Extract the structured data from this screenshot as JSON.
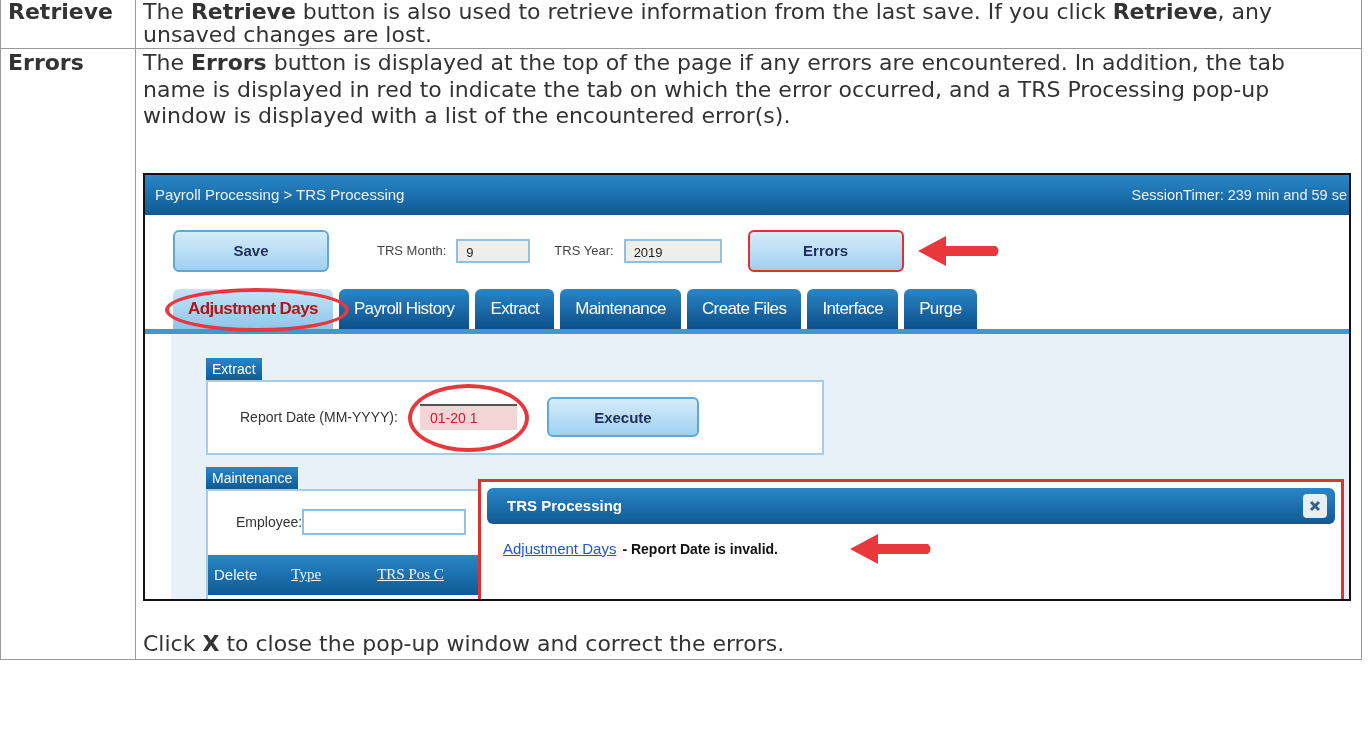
{
  "rows": [
    {
      "term": "Retrieve",
      "text": "The **Retrieve** button is also used to retrieve information from the last save. If you click **Retrieve**, any unsaved changes are lost."
    },
    {
      "term": "Errors",
      "text": "The **Errors** button is displayed at the top of the page if any errors are encountered. In addition, the tab name is displayed in red to indicate the tab on which the error occurred, and a TRS Processing pop-up window is displayed with a list of the encountered error(s).",
      "after": "Click **X** to close the pop-up window and correct the errors.",
      "screenshot": {
        "breadcrumb": "Payroll Processing > TRS Processing",
        "session_timer": "SessionTimer: 239 min and 59 se",
        "save_button": "Save",
        "month_label": "TRS Month:",
        "month_value": "9",
        "year_label": "TRS Year:",
        "year_value": "2019",
        "errors_button": "Errors",
        "tabs": [
          {
            "label": "Adjustment Days",
            "selected": true,
            "error": true
          },
          {
            "label": "Payroll History",
            "selected": false,
            "error": false
          },
          {
            "label": "Extract",
            "selected": false,
            "error": false
          },
          {
            "label": "Maintenance",
            "selected": false,
            "error": false
          },
          {
            "label": "Create Files",
            "selected": false,
            "error": false
          },
          {
            "label": "Interface",
            "selected": false,
            "error": false
          },
          {
            "label": "Purge",
            "selected": false,
            "error": false
          }
        ],
        "extract": {
          "title": "Extract",
          "label": "Report Date (MM-YYYY):",
          "value": "01-20 1",
          "invalid": true,
          "button": "Execute"
        },
        "maintenance": {
          "title": "Maintenance",
          "employee_label": "Employee:",
          "columns": [
            "Delete",
            "Type",
            "TRS Pos C"
          ]
        },
        "popup": {
          "title": "TRS Processing",
          "link": "Adjustment Days",
          "message": "- Report Date is invalid."
        }
      }
    }
  ]
}
